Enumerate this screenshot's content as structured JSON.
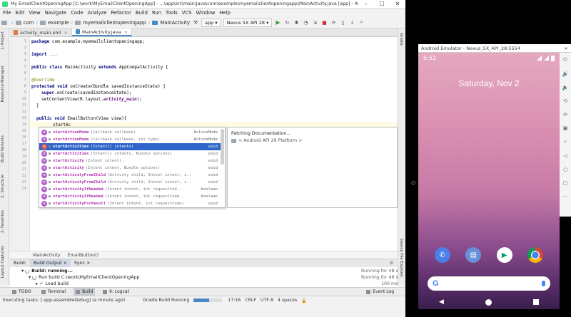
{
  "window": {
    "title": "My EmailClientOpeningApp [C:\\work\\MyEmailClientOpeningApp] - ...\\app\\src\\main\\java\\com\\example\\myemailclientopeningapp\\MainActivity.java [app] - Android Studio",
    "minimize": "–",
    "maximize": "☐",
    "close": "✕"
  },
  "menu": [
    "File",
    "Edit",
    "View",
    "Navigate",
    "Code",
    "Analyze",
    "Refactor",
    "Build",
    "Run",
    "Tools",
    "VCS",
    "Window",
    "Help"
  ],
  "breadcrumb": [
    "com",
    "example",
    "myemailclientopeningapp",
    "MainActivity"
  ],
  "toolbar": {
    "module": "app",
    "device": "Nexus 5X API 28"
  },
  "left_tools": [
    "1: Project",
    "Resource Manager",
    "Build Variants",
    "2: Structure",
    "2: Favorites",
    "Layout Captures"
  ],
  "right_tools": [
    "Gradle",
    "Device File Explorer"
  ],
  "tabs": [
    {
      "label": "activity_main.xml",
      "close": "×"
    },
    {
      "label": "MainActivity.java",
      "close": "×"
    }
  ],
  "editor": {
    "line_numbers": [
      "1",
      "2",
      "3",
      "4",
      "5",
      "6",
      "7",
      "8",
      "9",
      "10",
      "11",
      "12",
      "13",
      "14",
      "15",
      "16",
      "17",
      "18",
      "19",
      "20",
      "21",
      "22",
      "23",
      "24"
    ],
    "lines": {
      "l1_kw": "package",
      "l1_rest": " com.example.myemailclientopeningapp;",
      "l3_kw": "import",
      "l3_rest": " ...",
      "l7_kw": "public class",
      "l7_name": " MainActivity ",
      "l7_kw2": "extends",
      "l7_rest": " AppCompatActivity {",
      "l9_ann": "@Override",
      "l10_kw": "protected void",
      "l10_rest": " onCreate(Bundle savedInstanceState) {",
      "l11_kw": "super",
      "l11_rest": ".onCreate(savedInstanceState);",
      "l12_a": "setContentView(R.layout.",
      "l12_fld": "activity_main",
      "l12_b": ");",
      "l13": "}",
      "l16_kw": "public void",
      "l16_rest": " EmailButton(View view){",
      "l17": "startAc"
    }
  },
  "autocomplete": {
    "items": [
      {
        "name": "startActionMode",
        "params": "(Callback callback)",
        "ret": "ActionMode"
      },
      {
        "name": "startActionMode",
        "params": "(Callback callback, int type)",
        "ret": "ActionMode"
      },
      {
        "name": "startActivities",
        "params": "(Intent[] intents)",
        "ret": "void"
      },
      {
        "name": "startActivities",
        "params": "(Intent[] intents, Bundle options)",
        "ret": "void"
      },
      {
        "name": "startActivity",
        "params": "(Intent intent)",
        "ret": "void"
      },
      {
        "name": "startActivity",
        "params": "(Intent intent, Bundle options)",
        "ret": "void"
      },
      {
        "name": "startActivityFromChild",
        "params": "(Activity child, Intent intent, i...",
        "ret": "void"
      },
      {
        "name": "startActivityFromChild",
        "params": "(Activity child, Intent intent, i...",
        "ret": "void"
      },
      {
        "name": "startActivityIfNeeded",
        "params": "(Intent intent, int requestCod...",
        "ret": "boolean"
      },
      {
        "name": "startActivityIfNeeded",
        "params": "(Intent intent, int requestCode...",
        "ret": "boolean"
      },
      {
        "name": "startActivityForResult",
        "params": "(Intent intent, int requestCode)",
        "ret": "void"
      }
    ],
    "selected_index": 2,
    "badge": "m"
  },
  "documentation": {
    "status": "Fetching Documentation...",
    "platform": "< Android API 29 Platform >"
  },
  "editor_breadcrumb": [
    "MainActivity",
    "EmailButton()"
  ],
  "build": {
    "header": "Build:",
    "tabs": [
      "Build Output",
      "Sync"
    ],
    "rows": [
      {
        "text": "Build: running...",
        "time": "Running for 48 s"
      },
      {
        "text": "Run build C:\\work\\MyEmailClientOpeningApp",
        "time": "Running for 48 s"
      },
      {
        "text": "Load build",
        "time": "100 ms"
      }
    ]
  },
  "tool_windows": [
    "TODO",
    "Terminal",
    "Build",
    "6: Logcat"
  ],
  "event_log": "Event Log",
  "status": {
    "message": "Executing tasks: [:app:assembleDebug] (a minute ago)",
    "gradle": "Gradle Build Running",
    "progress": 0.55,
    "position": "17:16",
    "line_sep": "CRLF",
    "encoding": "UTF-8",
    "indent": "4 spaces"
  },
  "emulator": {
    "title": "Android Emulator - Nexus_5X_API_28:5554",
    "close": "×",
    "time": "6:52",
    "date": "Saturday, Nov 2",
    "search_logo": "G"
  },
  "colors": {
    "selection": "#2f65ca",
    "method_name": "#b030b0",
    "keyword": "#000080"
  }
}
